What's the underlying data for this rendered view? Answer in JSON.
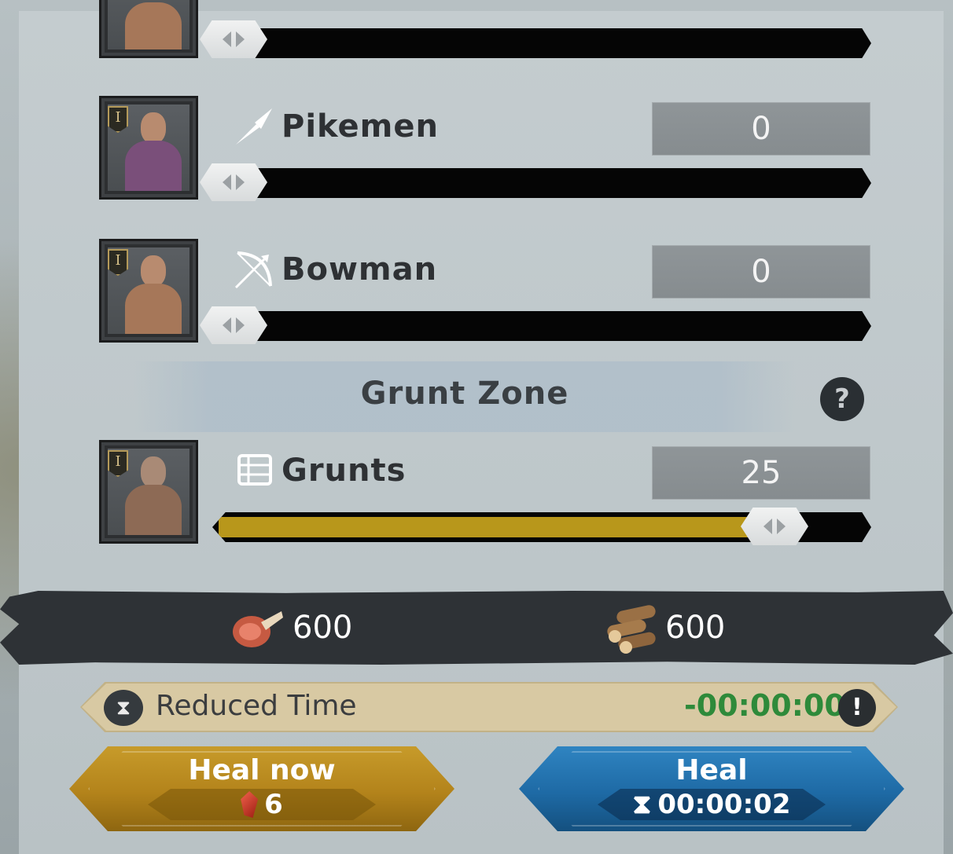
{
  "troops": [
    {
      "name": "",
      "count": "",
      "tier": "",
      "icon": "partial-unit-icon",
      "slider_value": 0
    },
    {
      "name": "Pikemen",
      "count": "0",
      "tier": "I",
      "icon": "spear-icon",
      "slider_value": 0
    },
    {
      "name": "Bowman",
      "count": "0",
      "tier": "I",
      "icon": "bow-icon",
      "slider_value": 0
    }
  ],
  "grunt_zone": {
    "title": "Grunt Zone",
    "help_icon": "question-icon",
    "help_symbol": "?",
    "troop": {
      "name": "Grunts",
      "count": "25",
      "tier": "I",
      "icon": "supply-crate-icon",
      "slider_fraction": 0.86
    }
  },
  "resources": {
    "food": {
      "icon": "meat-icon",
      "value": "600"
    },
    "wood": {
      "icon": "logs-icon",
      "value": "600"
    }
  },
  "reduced_time": {
    "icon": "hourglass-icon",
    "label": "Reduced Time",
    "value": "-00:00:00",
    "warning_icon": "exclamation-icon",
    "warning_symbol": "!",
    "value_color": "#2e8a3a"
  },
  "buttons": {
    "heal_now": {
      "label": "Heal now",
      "cost": "6",
      "cost_icon": "gem-icon",
      "color": "#b3831b"
    },
    "heal": {
      "label": "Heal",
      "time": "00:00:02",
      "time_icon": "hourglass-icon",
      "color": "#1e6aa5"
    }
  },
  "symbols": {
    "hourglass": "⧗"
  }
}
